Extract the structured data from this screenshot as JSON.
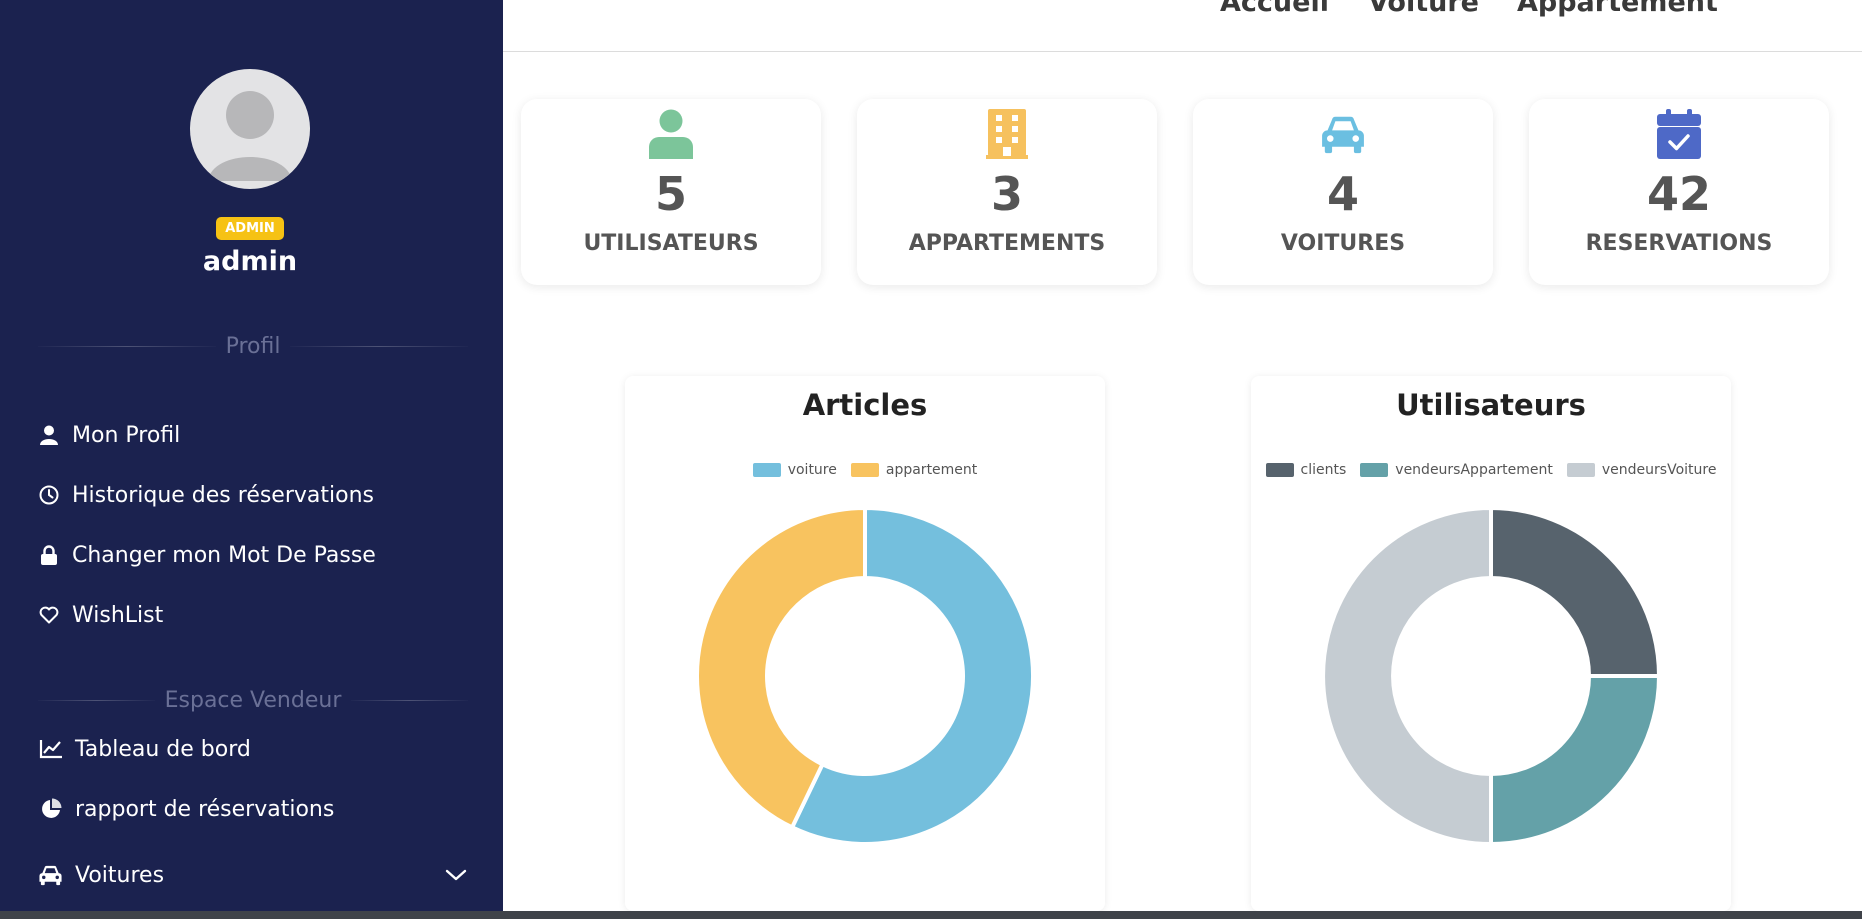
{
  "sidebar": {
    "role_badge": "ADMIN",
    "username": "admin",
    "section_profile": "Profil",
    "profile_items": [
      {
        "label": "Mon Profil",
        "icon": "user-icon"
      },
      {
        "label": "Historique des réservations",
        "icon": "clock-icon"
      },
      {
        "label": "Changer mon Mot De Passe",
        "icon": "lock-icon"
      },
      {
        "label": "WishList",
        "icon": "heart-icon"
      }
    ],
    "section_vendor": "Espace Vendeur",
    "vendor_items": [
      {
        "label": "Tableau de bord",
        "icon": "line-chart-icon"
      },
      {
        "label": "rapport de réservations",
        "icon": "pie-chart-icon"
      },
      {
        "label": "Voitures",
        "icon": "car-icon"
      }
    ]
  },
  "topnav": {
    "links": [
      "Accueil",
      "Voiture",
      "Appartement"
    ]
  },
  "stats": [
    {
      "value": "5",
      "label": "UTILISATEURS",
      "icon": "user-icon",
      "color": "#7cc59a"
    },
    {
      "value": "3",
      "label": "APPARTEMENTS",
      "icon": "building-icon",
      "color": "#f6c15e"
    },
    {
      "value": "4",
      "label": "VOITURES",
      "icon": "car-icon",
      "color": "#6bbfe1"
    },
    {
      "value": "42",
      "label": "RESERVATIONS",
      "icon": "calendar-check-icon",
      "color": "#4e69c7"
    }
  ],
  "chart_data": [
    {
      "type": "pie",
      "title": "Articles",
      "categories": [
        "voiture",
        "appartement"
      ],
      "values": [
        4,
        3
      ],
      "colors": [
        "#74bfdd",
        "#f8c35f"
      ],
      "legend": "top"
    },
    {
      "type": "pie",
      "title": "Utilisateurs",
      "categories": [
        "clients",
        "vendeursAppartement",
        "vendeursVoiture"
      ],
      "values": [
        1,
        1,
        2
      ],
      "colors": [
        "#57636d",
        "#64a1a8",
        "#c5ccd2"
      ],
      "legend": "top"
    }
  ]
}
